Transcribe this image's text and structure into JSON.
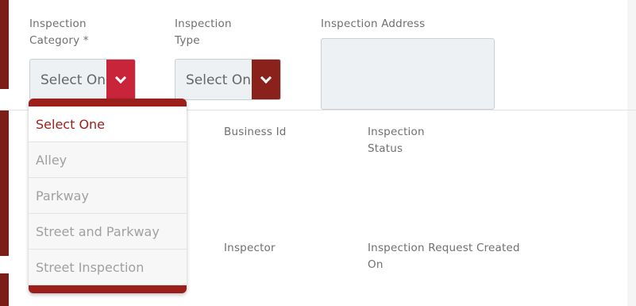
{
  "form": {
    "category_label_line1": "Inspection",
    "category_label_line2": "Category *",
    "type_label_line1": "Inspection",
    "type_label_line2": "Type",
    "address_label": "Inspection Address",
    "category_select_value": "Select One",
    "type_select_value": "Select One",
    "business_id_label": "Business Id",
    "status_label_line1": "Inspection",
    "status_label_line2": "Status",
    "inspector_label": "Inspector",
    "created_label_line1": "Inspection Request Created",
    "created_label_line2": "On"
  },
  "dropdown": {
    "options": [
      "Select One",
      "Alley",
      "Parkway",
      "Street and Parkway",
      "Street Inspection"
    ],
    "selected_index": 0
  },
  "colors": {
    "brand_dark_red": "#8b211b",
    "accent_red": "#c8253b",
    "dropdown_frame": "#9b1f1b",
    "field_bg": "#edf1f4",
    "label_gray": "#6f6f6f"
  }
}
